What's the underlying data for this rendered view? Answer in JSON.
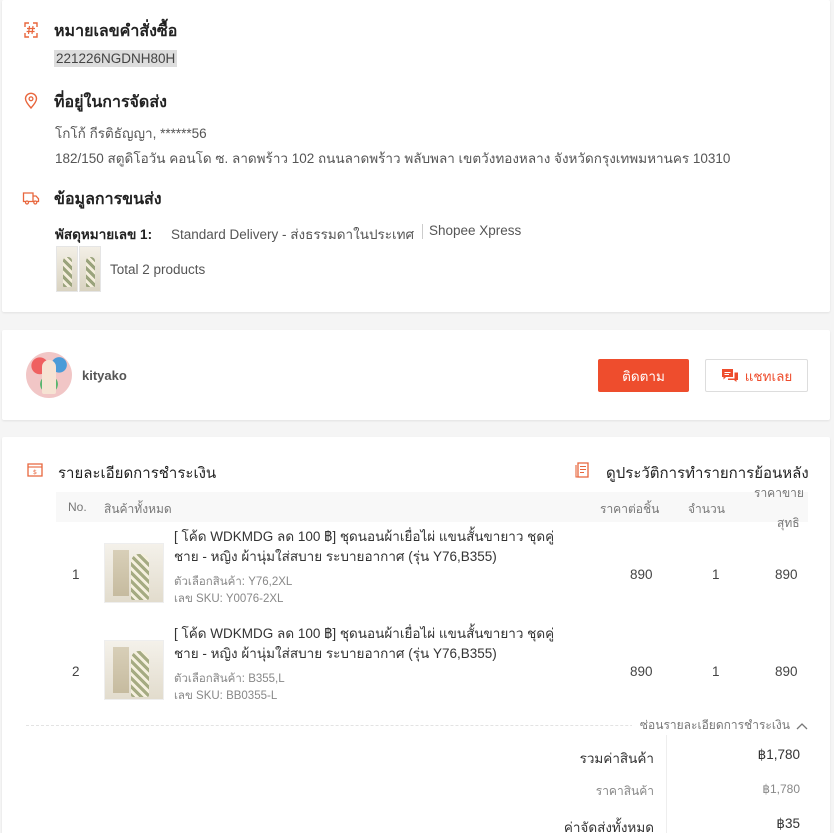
{
  "order": {
    "title": "หมายเลขคำสั่งซื้อ",
    "number": "221226NGDNH80H"
  },
  "address": {
    "title": "ที่อยู่ในการจัดส่ง",
    "recipient": "โกโก้ กีรติธัญญา, ******56",
    "full": "182/150 สตูดิโอวัน คอนโด ซ. ลาดพร้าว 102 ถนนลาดพร้าว พลับพลา เขตวังทองหลาง จังหวัดกรุงเทพมหานคร 10310"
  },
  "shipping": {
    "title": "ข้อมูลการขนส่ง",
    "package_label": "พัสดุหมายเลข 1:",
    "delivery_type": "Standard Delivery - ส่งธรรมดาในประเทศ",
    "courier": "Shopee Xpress",
    "total_products": "Total 2 products"
  },
  "shop": {
    "name": "kityako",
    "follow_label": "ติดตาม",
    "chat_label": "แชทเลย"
  },
  "payment": {
    "title": "รายละเอียดการชำระเงิน",
    "history_link": "ดูประวัติการทำรายการย้อนหลัง",
    "columns": {
      "no": "No.",
      "products": "สินค้าทั้งหมด",
      "unit_price": "ราคาต่อชิ้น",
      "qty": "จำนวน",
      "net_line1": "ราคาขาย",
      "net_line2": "สุทธิ"
    },
    "items": [
      {
        "no": "1",
        "name": "[ โค้ด WDKMDG ลด 100 ฿] ชุดนอนผ้าเยื่อไผ่ แขนสั้นขายาว ชุดคู่ชาย - หญิง ผ้านุ่มใส่สบาย ระบายอากาศ (รุ่น Y76,B355)",
        "variation": "ตัวเลือกสินค้า: Y76,2XL",
        "sku": "เลข SKU: Y0076-2XL",
        "unit_price": "890",
        "qty": "1",
        "net": "890"
      },
      {
        "no": "2",
        "name": "[ โค้ด WDKMDG ลด 100 ฿] ชุดนอนผ้าเยื่อไผ่ แขนสั้นขายาว ชุดคู่ชาย - หญิง ผ้านุ่มใส่สบาย ระบายอากาศ (รุ่น Y76,B355)",
        "variation": "ตัวเลือกสินค้า: B355,L",
        "sku": "เลข SKU: BB0355-L",
        "unit_price": "890",
        "qty": "1",
        "net": "890"
      }
    ],
    "collapse_label": "ซ่อนรายละเอียดการชำระเงิน",
    "summary": {
      "subtotal_label": "รวมค่าสินค้า",
      "subtotal_value": "฿1,780",
      "price_label": "ราคาสินค้า",
      "price_value": "฿1,780",
      "shipping_label": "ค่าจัดส่งทั้งหมด",
      "shipping_value": "฿35"
    }
  },
  "colors": {
    "accent": "#ee4d2d",
    "icon": "#e8663d"
  }
}
